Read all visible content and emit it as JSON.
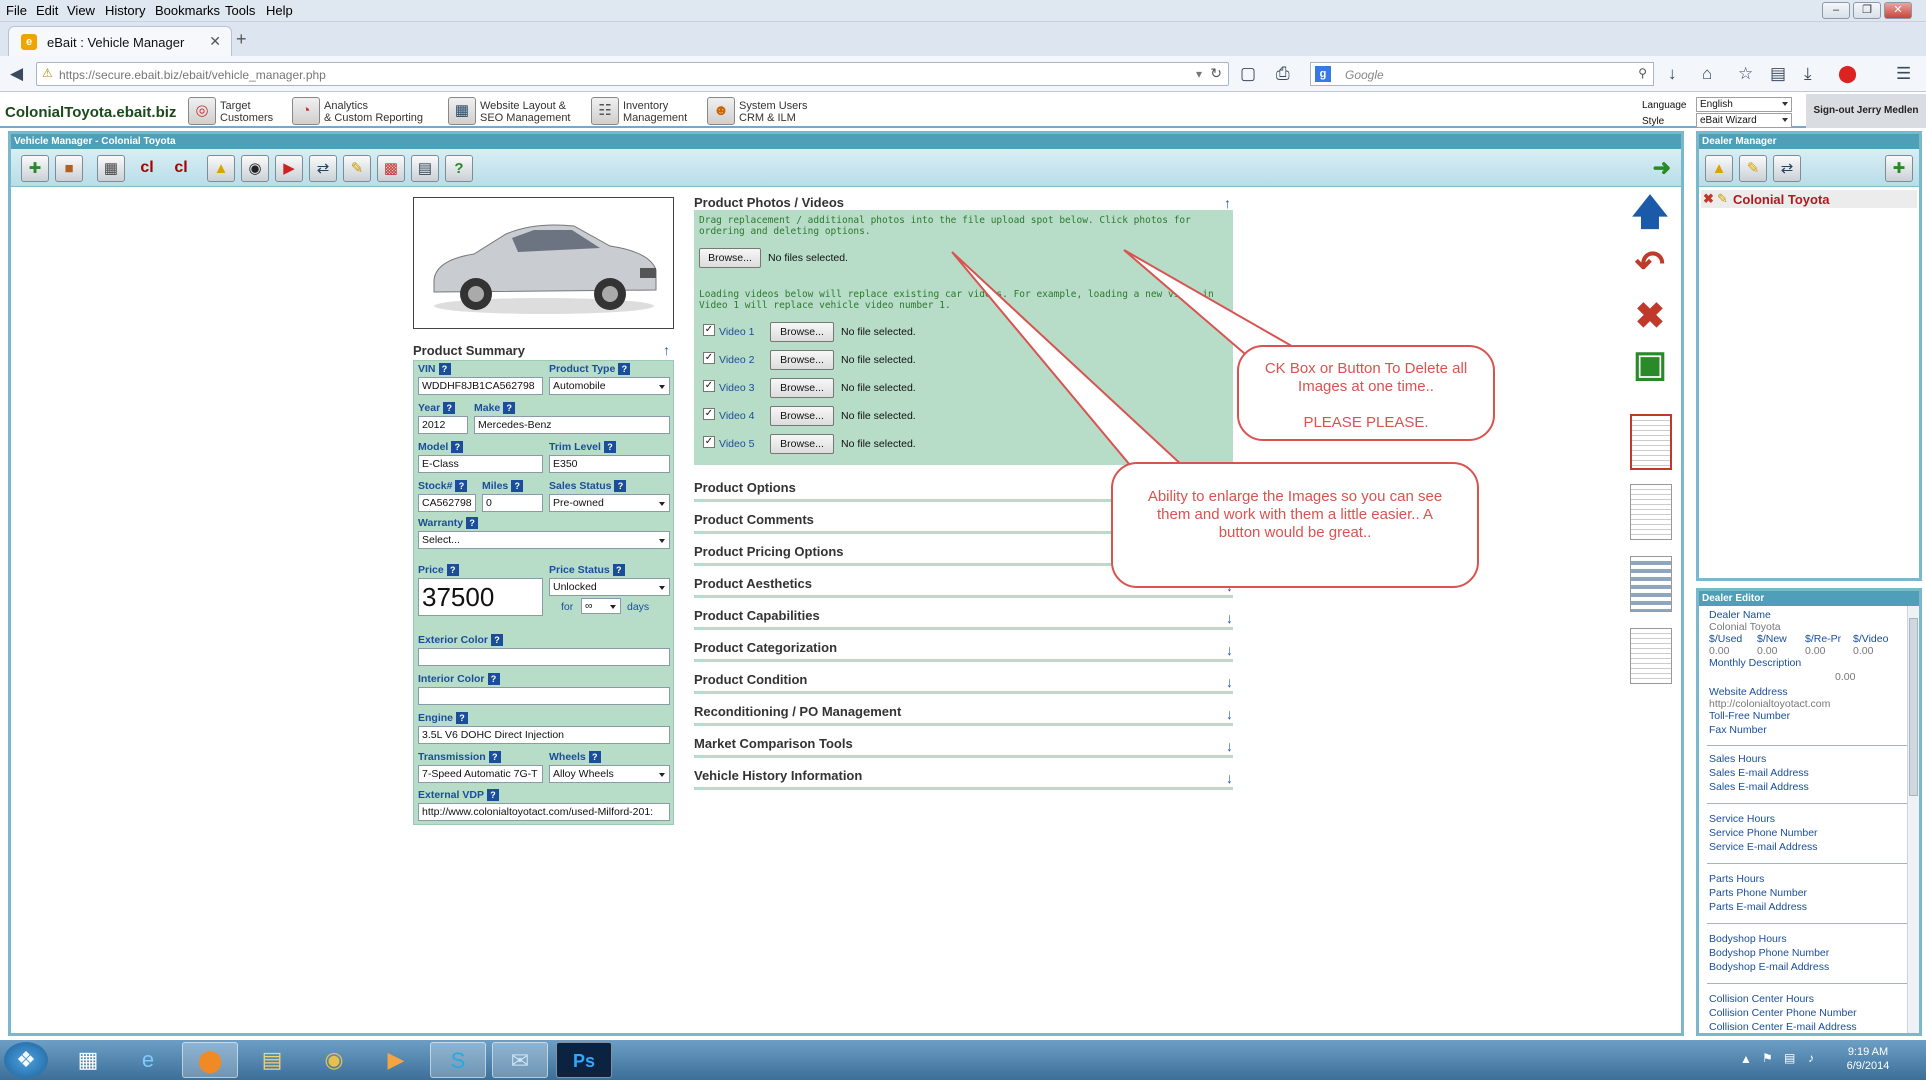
{
  "menubar": {
    "items": [
      "File",
      "Edit",
      "View",
      "History",
      "Bookmarks",
      "Tools",
      "Help"
    ]
  },
  "browser": {
    "tab_title": "eBait : Vehicle Manager",
    "url": "https://secure.ebait.biz/ebait/vehicle_manager.php",
    "search_placeholder": "Google"
  },
  "app": {
    "site_name": "ColonialToyota.ebait.biz",
    "modules": [
      {
        "line1": "Target",
        "line2": "Customers",
        "icon": "target-icon"
      },
      {
        "line1": "Analytics",
        "line2": "& Custom Reporting",
        "icon": "analytics-icon"
      },
      {
        "line1": "Website Layout &",
        "line2": "SEO Management",
        "icon": "website-icon"
      },
      {
        "line1": "Inventory",
        "line2": "Management",
        "icon": "inventory-icon"
      },
      {
        "line1": "System Users",
        "line2": "CRM & ILM",
        "icon": "users-icon"
      }
    ],
    "language_label": "Language",
    "language_value": "English",
    "style_label": "Style",
    "style_value": "eBait Wizard",
    "signout": "Sign-out Jerry Medlen"
  },
  "vehicle_manager": {
    "title": "Vehicle Manager - Colonial Toyota",
    "toolbar_text_icons": [
      "cl",
      "cl"
    ]
  },
  "summary": {
    "heading": "Product Summary",
    "vin_label": "VIN",
    "vin": "WDDHF8JB1CA562798",
    "product_type_label": "Product Type",
    "product_type": "Automobile",
    "year_label": "Year",
    "year": "2012",
    "make_label": "Make",
    "make": "Mercedes-Benz",
    "model_label": "Model",
    "model": "E-Class",
    "trim_label": "Trim Level",
    "trim": "E350",
    "stock_label": "Stock#",
    "stock": "CA562798",
    "miles_label": "Miles",
    "miles": "0",
    "sales_status_label": "Sales Status",
    "sales_status": "Pre-owned",
    "warranty_label": "Warranty",
    "warranty": "Select...",
    "price_label": "Price",
    "price": "37500",
    "price_status_label": "Price Status",
    "price_status": "Unlocked",
    "for_label": "for",
    "for_value": "∞",
    "days_label": "days",
    "exterior_label": "Exterior Color",
    "exterior": "",
    "interior_label": "Interior Color",
    "interior": "",
    "engine_label": "Engine",
    "engine": "3.5L V6 DOHC Direct Injection",
    "transmission_label": "Transmission",
    "transmission": "7-Speed Automatic 7G-T",
    "wheels_label": "Wheels",
    "wheels": "Alloy Wheels",
    "vdp_label": "External VDP",
    "vdp": "http://www.colonialtoyotact.com/used-Milford-201:"
  },
  "photos": {
    "heading": "Product Photos / Videos",
    "instructions": "Drag replacement / additional photos into the file upload spot below. Click photos for ordering and deleting options.",
    "browse_label": "Browse...",
    "no_files": "No files selected.",
    "video_note": "Loading videos below will replace existing car videos. For example, loading a new video in Video 1 will replace vehicle video number 1.",
    "videos": [
      {
        "label": "Video 1",
        "status": "No file selected."
      },
      {
        "label": "Video 2",
        "status": "No file selected."
      },
      {
        "label": "Video 3",
        "status": "No file selected."
      },
      {
        "label": "Video 4",
        "status": "No file selected."
      },
      {
        "label": "Video 5",
        "status": "No file selected."
      }
    ]
  },
  "sections": [
    "Product Options",
    "Product Comments",
    "Product Pricing Options",
    "Product Aesthetics",
    "Product Capabilities",
    "Product Categorization",
    "Product Condition",
    "Reconditioning / PO Management",
    "Market Comparison Tools",
    "Vehicle History Information"
  ],
  "callouts": {
    "one": "CK Box or Button To Delete all Images at one time..",
    "one_b": "PLEASE PLEASE.",
    "two": "Ability to enlarge the Images so you can see them and work with them a little easier.. A button would be great.."
  },
  "dealer_manager": {
    "title": "Dealer Manager",
    "dealer": "Colonial Toyota"
  },
  "dealer_editor": {
    "title": "Dealer Editor",
    "name_label": "Dealer Name",
    "name": "Colonial Toyota",
    "cols": [
      "$/Used",
      "$/New",
      "$/Re-Pr",
      "$/Video"
    ],
    "col_values": [
      "0.00",
      "0.00",
      "0.00",
      "0.00"
    ],
    "monthly_label": "Monthly Description",
    "monthly": "0.00",
    "website_label": "Website Address",
    "website": "http://colonialtoyotact.com",
    "tollfree_label": "Toll-Free Number",
    "fax_label": "Fax Number",
    "groups": [
      [
        "Sales Hours",
        "Sales E-mail Address",
        "Sales E-mail Address"
      ],
      [
        "Service Hours",
        "Service Phone Number",
        "Service E-mail Address"
      ],
      [
        "Parts Hours",
        "Parts Phone Number",
        "Parts E-mail Address"
      ],
      [
        "Bodyshop Hours",
        "Bodyshop Phone Number",
        "Bodyshop E-mail Address"
      ],
      [
        "Collision Center Hours",
        "Collision Center Phone Number",
        "Collision Center E-mail Address"
      ]
    ]
  },
  "taskbar": {
    "time": "9:19 AM",
    "date": "6/9/2014"
  }
}
